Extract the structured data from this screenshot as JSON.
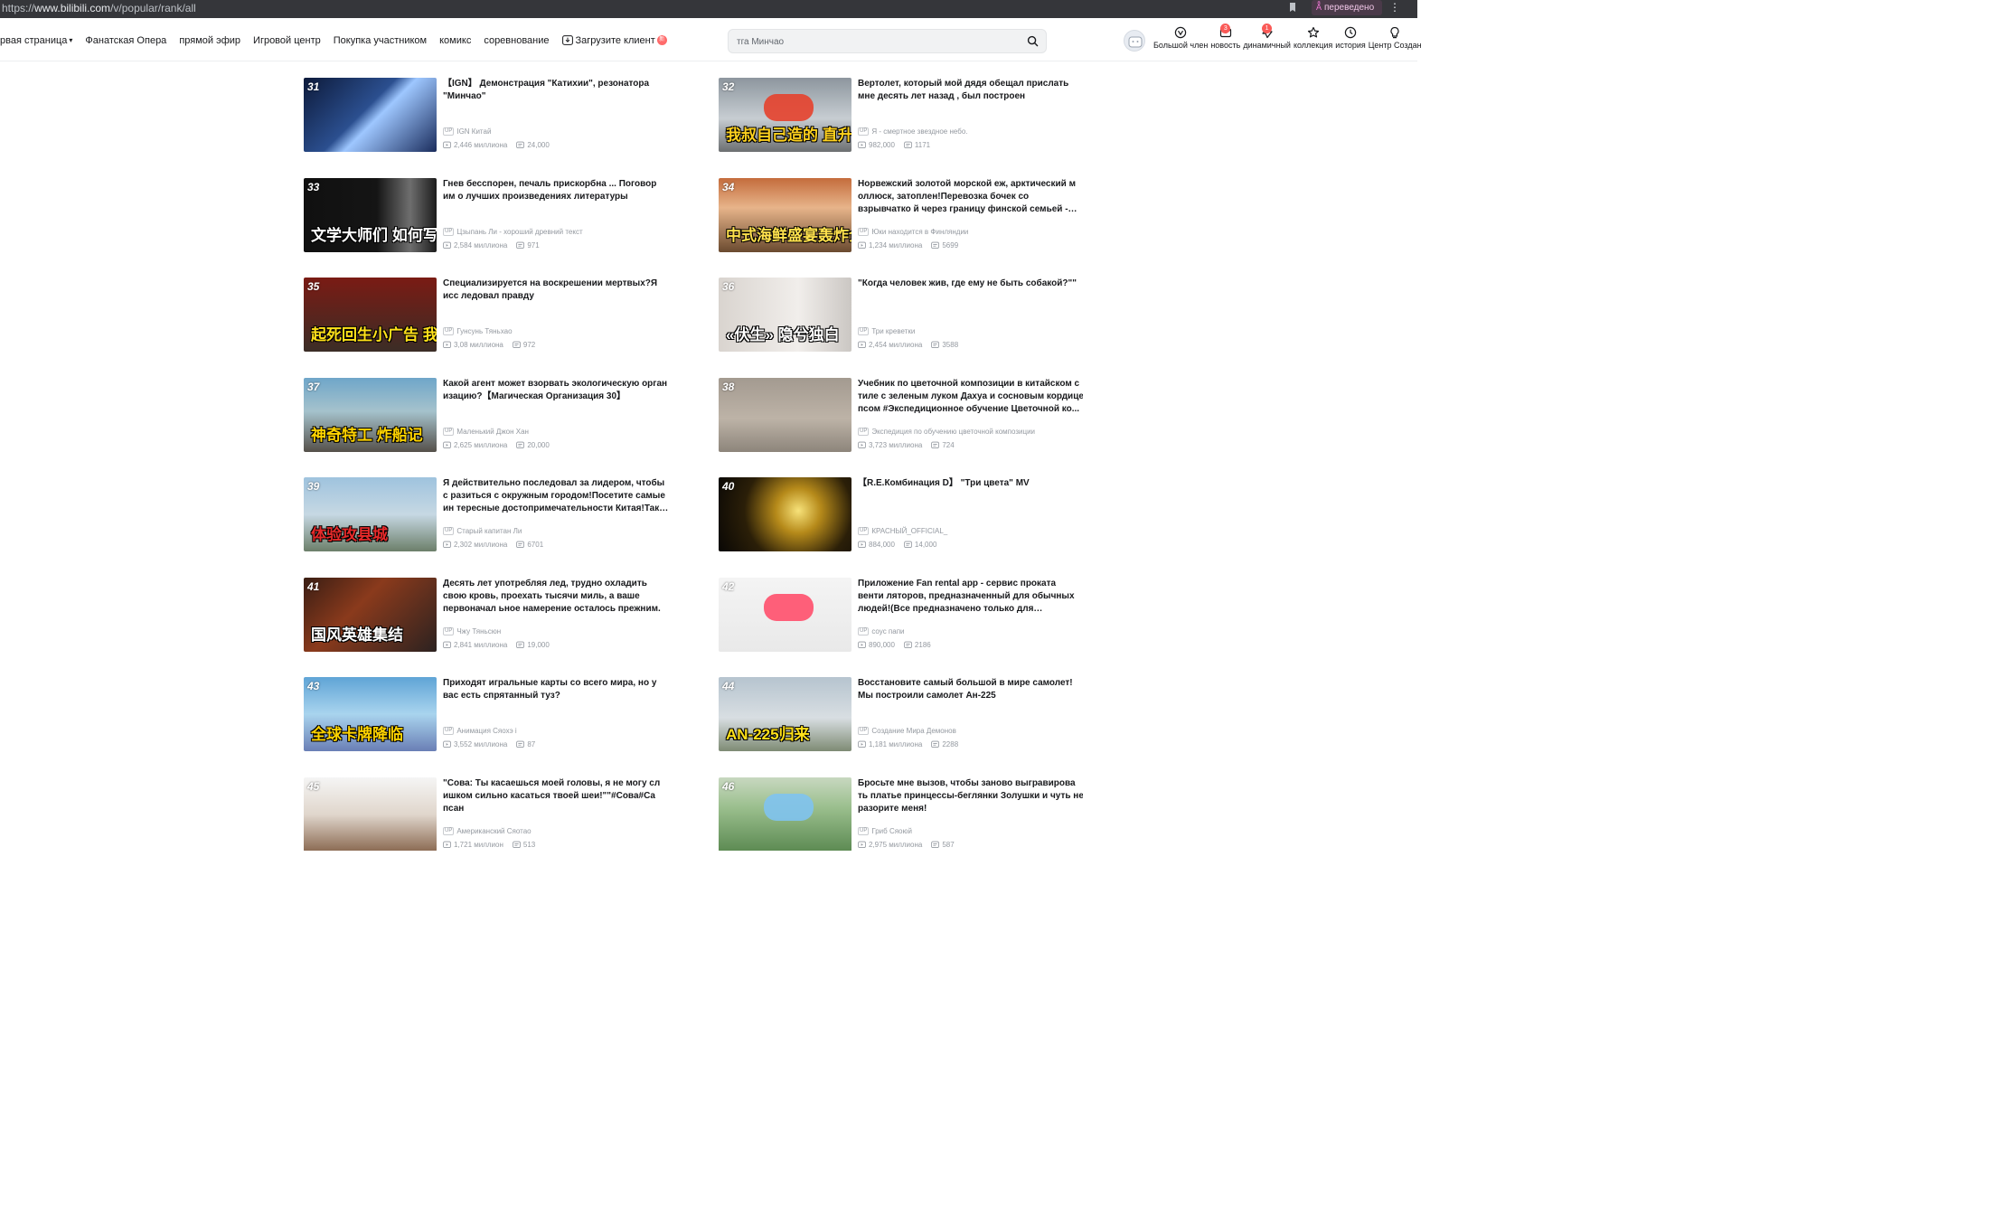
{
  "browser": {
    "url_scheme": "https://",
    "url_host": "www.bilibili.com",
    "url_path": "/v/popular/rank/all",
    "translated_label": "переведено"
  },
  "header": {
    "nav": [
      {
        "label": "рвая страница",
        "dropdown": true
      },
      {
        "label": "Фанатская Опера"
      },
      {
        "label": "прямой эфир"
      },
      {
        "label": "Игровой центр"
      },
      {
        "label": "Покупка участником"
      },
      {
        "label": "комикс"
      },
      {
        "label": "соревнование"
      },
      {
        "label": "Загрузите клиент",
        "download": true,
        "badge": "新"
      }
    ],
    "search": {
      "placeholder": "тга Минчао"
    },
    "right": [
      {
        "label": "Большой член",
        "icon": "vip-icon"
      },
      {
        "label": "новость",
        "icon": "message-icon",
        "badge": "3"
      },
      {
        "label": "динамичный",
        "icon": "dynamic-icon",
        "badge": "1"
      },
      {
        "label": "коллекция",
        "icon": "star-icon"
      },
      {
        "label": "история",
        "icon": "clock-icon"
      },
      {
        "label": "Центр Создан",
        "icon": "bulb-icon"
      }
    ]
  },
  "rank": {
    "items": [
      {
        "rank": "31",
        "title": "【IGN】 Демонстрация \"Катихии\", резонатора \"Минчао\"",
        "up": "IGN Китай",
        "views": "2,446 миллиона",
        "danmaku": "24,000",
        "thumb": {
          "bg": "linear-gradient(135deg,#0d1a3a 0%,#2b4f8f 45%,#9ec7ff 55%,#1a2c5c 100%)"
        }
      },
      {
        "rank": "32",
        "title": "Вертолет, который мой дядя обещал прислать мне десять лет назад , был построен",
        "up": "Я - смертное звездное небо.",
        "views": "982,000",
        "danmaku": "1171",
        "thumb": {
          "bg": "linear-gradient(180deg,#8d969e 0%,#c7cdd2 55%,#6c6f71 100%)",
          "caption": "我叔自己造的 直升飞机",
          "caption_color": "#ffd21e",
          "accent": "#e5412c"
        }
      },
      {
        "rank": "33",
        "title": "Гнев бесспорен, печаль прискорбна ... Поговор им о лучших произведениях литературы",
        "up": "Цзыпань Ли - хороший древний текст",
        "views": "2,584 миллиона",
        "danmaku": "971",
        "thumb": {
          "bg": "linear-gradient(90deg,#101010 0%,#151515 55%,#6e6e6e 80%,#1c1c1c 100%)",
          "caption": "文学大师们 如何写一个 可悲的人?",
          "caption_color": "#ffffff"
        }
      },
      {
        "rank": "34",
        "title": "Норвежский золотой морской еж, арктический м оллюск, затоплен!Перевозка бочек со взрывчатко й через границу финской семьей - это слишком ...",
        "up": "Юки находится в Финляндии",
        "views": "1,234 миллиона",
        "danmaku": "5699",
        "thumb": {
          "bg": "linear-gradient(180deg,#c46c3c 0%,#e7b48a 40%,#6a4a2f 100%)",
          "caption": "中式海鲜盛宴轰炸全场!",
          "caption_color": "#ffe14d"
        }
      },
      {
        "rank": "35",
        "title": "Специализируется на воскрешении мертвых?Я исс ледовал правду",
        "up": "Гунсунь Тяньхао",
        "views": "3,08 миллиона",
        "danmaku": "972",
        "thumb": {
          "bg": "linear-gradient(180deg,#7a1b14 0%,#3b2d26 100%)",
          "caption": "起死回生小广告 我调查了真相",
          "caption_color": "#ffe11a"
        }
      },
      {
        "rank": "36",
        "title": "\"Когда человек жив, где ему не быть собакой?\"\"",
        "up": "Три креветки",
        "views": "2,454 миллиона",
        "danmaku": "3588",
        "thumb": {
          "bg": "linear-gradient(90deg,#d9d4cf 0%,#f1eeeb 60%,#cbc7c3 100%)",
          "caption": "«伏生» 隐兮独白",
          "caption_color": "#ffffff"
        }
      },
      {
        "rank": "37",
        "title": "Какой агент может взорвать экологическую орган изацию?【Магическая Организация 30】",
        "up": "Маленький Джон Хан",
        "views": "2,625 миллиона",
        "danmaku": "20,000",
        "thumb": {
          "bg": "linear-gradient(180deg,#6fa6c9 0%,#a5c2cc 45%,#55504a 100%)",
          "caption": "神奇特工 炸船记",
          "caption_color": "#ffd400"
        }
      },
      {
        "rank": "38",
        "title": "Учебник по цветочной композиции в китайском с тиле с зеленым луком Дахуа и сосновым кордице псом #Экспедиционное обучение Цветочной ко...",
        "up": "Экспедиция по обучению цветочной композиции",
        "views": "3,723 миллиона",
        "danmaku": "724",
        "thumb": {
          "bg": "linear-gradient(180deg,#a39a90 0%,#bdb3a7 55%,#8d857b 100%)"
        }
      },
      {
        "rank": "39",
        "title": "Я действительно последовал за лидером, чтобы с разиться с окружным городом!Посетите самые ин тересные достопримечательности Китая!Так кру...",
        "up": "Старый капитан Ли",
        "views": "2,302 миллиона",
        "danmaku": "6701",
        "thumb": {
          "bg": "linear-gradient(180deg,#9fc3de 0%,#c6d8e3 50%,#6c7f6a 100%)",
          "caption": "体验攻县城",
          "caption_color": "#e52a2a"
        }
      },
      {
        "rank": "40",
        "title": "【R.E.Комбинация D】 \"Три цвета\" MV",
        "up": "КРАСНЫЙ_OFFICIAL_",
        "views": "884,000",
        "danmaku": "14,000",
        "thumb": {
          "bg": "radial-gradient(circle at 60% 45%,#f7e27a 0%,#b68a1a 25%,#2b1f08 60%,#090705 100%)"
        }
      },
      {
        "rank": "41",
        "title": "Десять лет употребляя лед, трудно охладить свою кровь, проехать тысячи миль, а ваше первоначал ьное намерение осталось прежним.",
        "up": "Чжу Тяньсюн",
        "views": "2,841 миллиона",
        "danmaku": "19,000",
        "thumb": {
          "bg": "linear-gradient(135deg,#3a1e14 0%,#8a3a1c 40%,#2c2220 100%)",
          "caption": "国风英雄集结",
          "caption_color": "#ffffff"
        }
      },
      {
        "rank": "42",
        "title": "Приложение Fan rental app - сервис проката венти ляторов, предназначенный для обычных людей!(Все предназначено только для разработки, пож...",
        "up": "соус папи",
        "views": "890,000",
        "danmaku": "2186",
        "thumb": {
          "bg": "linear-gradient(180deg,#f4f4f4 0%,#e9e9e9 100%)",
          "accent": "#ff4f6b"
        }
      },
      {
        "rank": "43",
        "title": "Приходят игральные карты со всего мира, но у вас есть спрятанный туз?",
        "up": "Анимация Сяохэ i",
        "views": "3,552 миллиона",
        "danmaku": "87",
        "thumb": {
          "bg": "linear-gradient(180deg,#5fa4d6 0%,#a9d4ee 50%,#6a7fb5 100%)",
          "caption": "全球卡牌降临",
          "caption_color": "#ffd400"
        }
      },
      {
        "rank": "44",
        "title": "Восстановите самый большой в мире самолет! Мы построили самолет Ан-225",
        "up": "Создание Мира Демонов",
        "views": "1,181 миллиона",
        "danmaku": "2288",
        "thumb": {
          "bg": "linear-gradient(180deg,#b6c4cf 0%,#d8dee2 55%,#7e8b74 100%)",
          "caption": "AN-225归来",
          "caption_color": "#ffe11a"
        }
      },
      {
        "rank": "45",
        "title": "\"Сова: Ты касаешься моей головы, я не могу сл ишком сильно касаться твоей шеи!\"\"#Сова#Са псан",
        "up": "Американский Сяотао",
        "views": "1,721 миллион",
        "danmaku": "513",
        "thumb": {
          "bg": "linear-gradient(180deg,#f5f5f5 0%,#e0d6cc 50%,#8b6a52 100%)"
        }
      },
      {
        "rank": "46",
        "title": "Бросьте мне вызов, чтобы заново выгравирова ть платье принцессы-беглянки Золушки и чуть не разорите меня!",
        "up": "Гриб Сяоюй",
        "views": "2,975 миллиона",
        "danmaku": "587",
        "thumb": {
          "bg": "linear-gradient(180deg,#c8d8c0 0%,#9bbf8e 40%,#5c8a52 100%)",
          "accent": "#7fc3ef"
        }
      }
    ]
  }
}
